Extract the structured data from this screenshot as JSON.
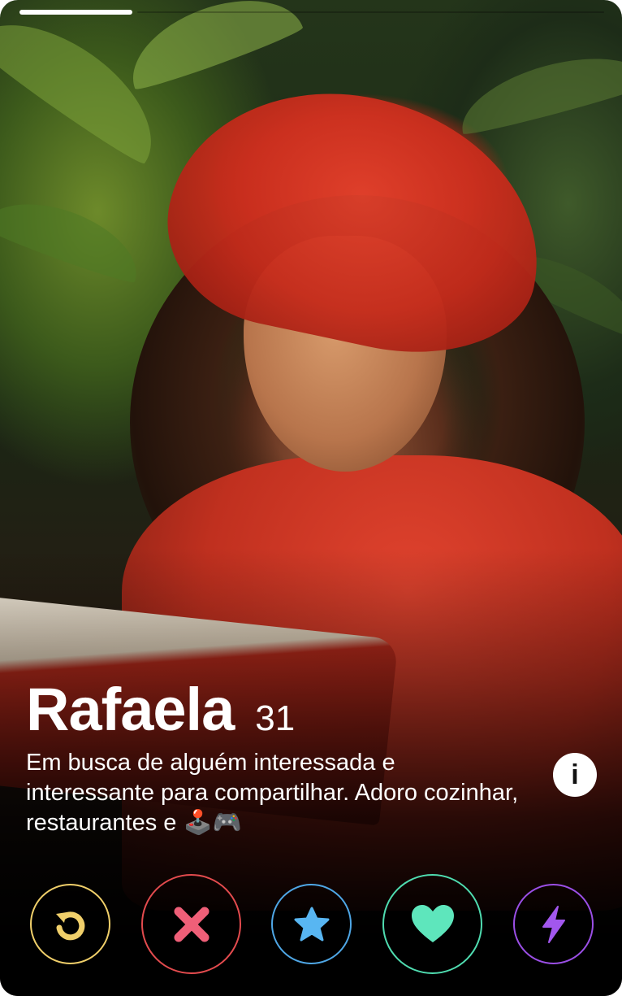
{
  "profile": {
    "name": "Rafaela",
    "age": "31",
    "bio": "Em busca de alguém interessada e interessante para compartilhar. Adoro cozinhar, restaurantes e 🕹️🎮",
    "photo_index": 1
  },
  "info_button": {
    "label": "i",
    "icon": "info-icon"
  },
  "actions": [
    {
      "name": "rewind",
      "icon": "rewind-icon",
      "color": "#f0cf6a"
    },
    {
      "name": "nope",
      "icon": "close-icon",
      "color": "#e34b4e"
    },
    {
      "name": "super-like",
      "icon": "star-icon",
      "color": "#4fa7e6"
    },
    {
      "name": "like",
      "icon": "heart-icon",
      "color": "#4fdcb0"
    },
    {
      "name": "boost",
      "icon": "lightning-icon",
      "color": "#9b4fe6"
    }
  ]
}
